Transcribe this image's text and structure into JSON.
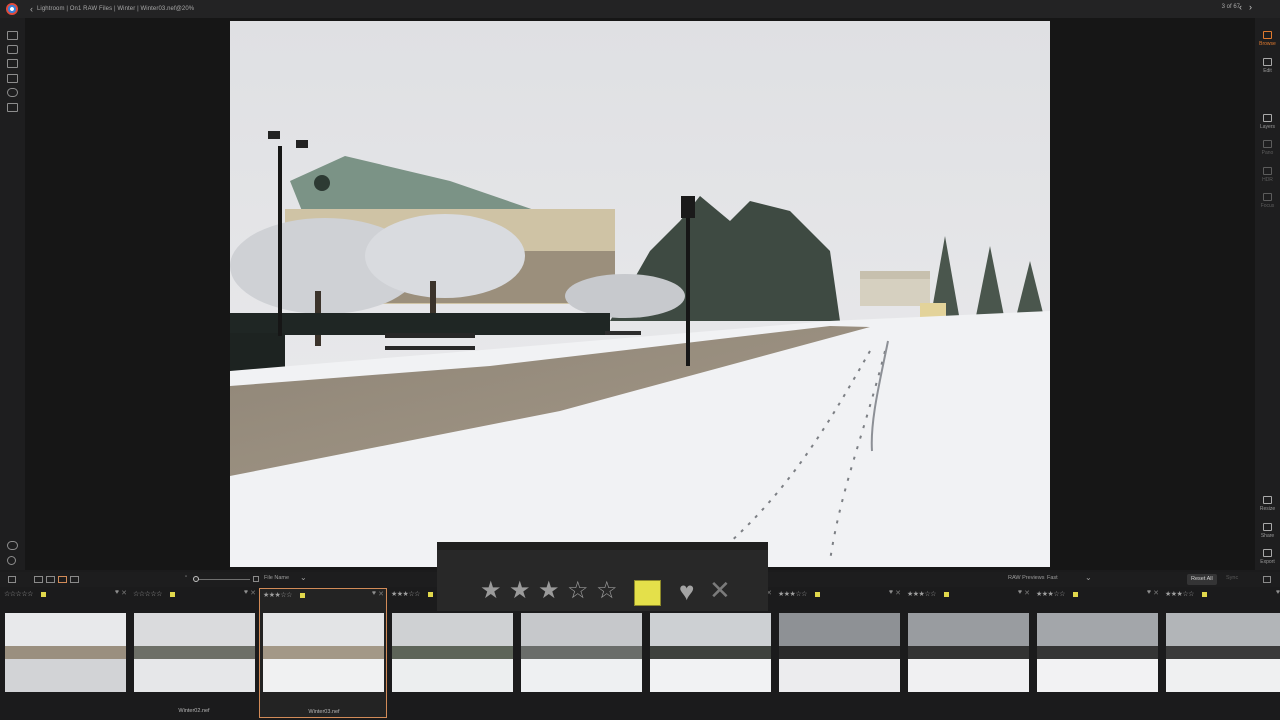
{
  "topbar": {
    "breadcrumb": "Lightroom | On1 RAW Files | Winter | Winter03.nef@20%",
    "pager": "3 of 67",
    "prev_icon": "chevron-left-icon",
    "next_icon": "chevron-right-icon"
  },
  "right_panel": {
    "items": [
      {
        "label": "Browse",
        "icon": "browse-icon",
        "active": true
      },
      {
        "label": "Edit",
        "icon": "sliders-icon"
      },
      {
        "label": "Layers",
        "icon": "layers-icon"
      },
      {
        "label": "Pano",
        "icon": "pano-icon",
        "disabled": true
      },
      {
        "label": "HDR",
        "icon": "hdr-icon",
        "disabled": true
      },
      {
        "label": "Focus",
        "icon": "focus-icon",
        "disabled": true
      },
      {
        "label": "Resize",
        "icon": "resize-icon"
      },
      {
        "label": "Share",
        "icon": "share-icon"
      },
      {
        "label": "Export",
        "icon": "export-icon"
      }
    ]
  },
  "toolbar": {
    "sort_label": "File Name",
    "raw_previews_label": "RAW Previews",
    "raw_previews_value": "Fast",
    "reset_all": "Reset All",
    "sync": "Sync"
  },
  "popup": {
    "rating": 3,
    "max_rating": 5,
    "color_label": "#e4e04a"
  },
  "filmstrip": [
    {
      "rating": 0,
      "filename": ""
    },
    {
      "rating": 0,
      "filename": "Winter02.nef"
    },
    {
      "rating": 3,
      "filename": "Winter03.nef",
      "selected": true
    },
    {
      "rating": 3,
      "filename": ""
    },
    {
      "rating": 0,
      "filename": ""
    },
    {
      "rating": 0,
      "filename": ""
    },
    {
      "rating": 3,
      "filename": ""
    },
    {
      "rating": 3,
      "filename": ""
    },
    {
      "rating": 3,
      "filename": ""
    },
    {
      "rating": 3,
      "filename": ""
    }
  ],
  "colors": {
    "accent": "#e07a2e",
    "selection": "#d28b58",
    "color_label_yellow": "#e1d84c"
  }
}
